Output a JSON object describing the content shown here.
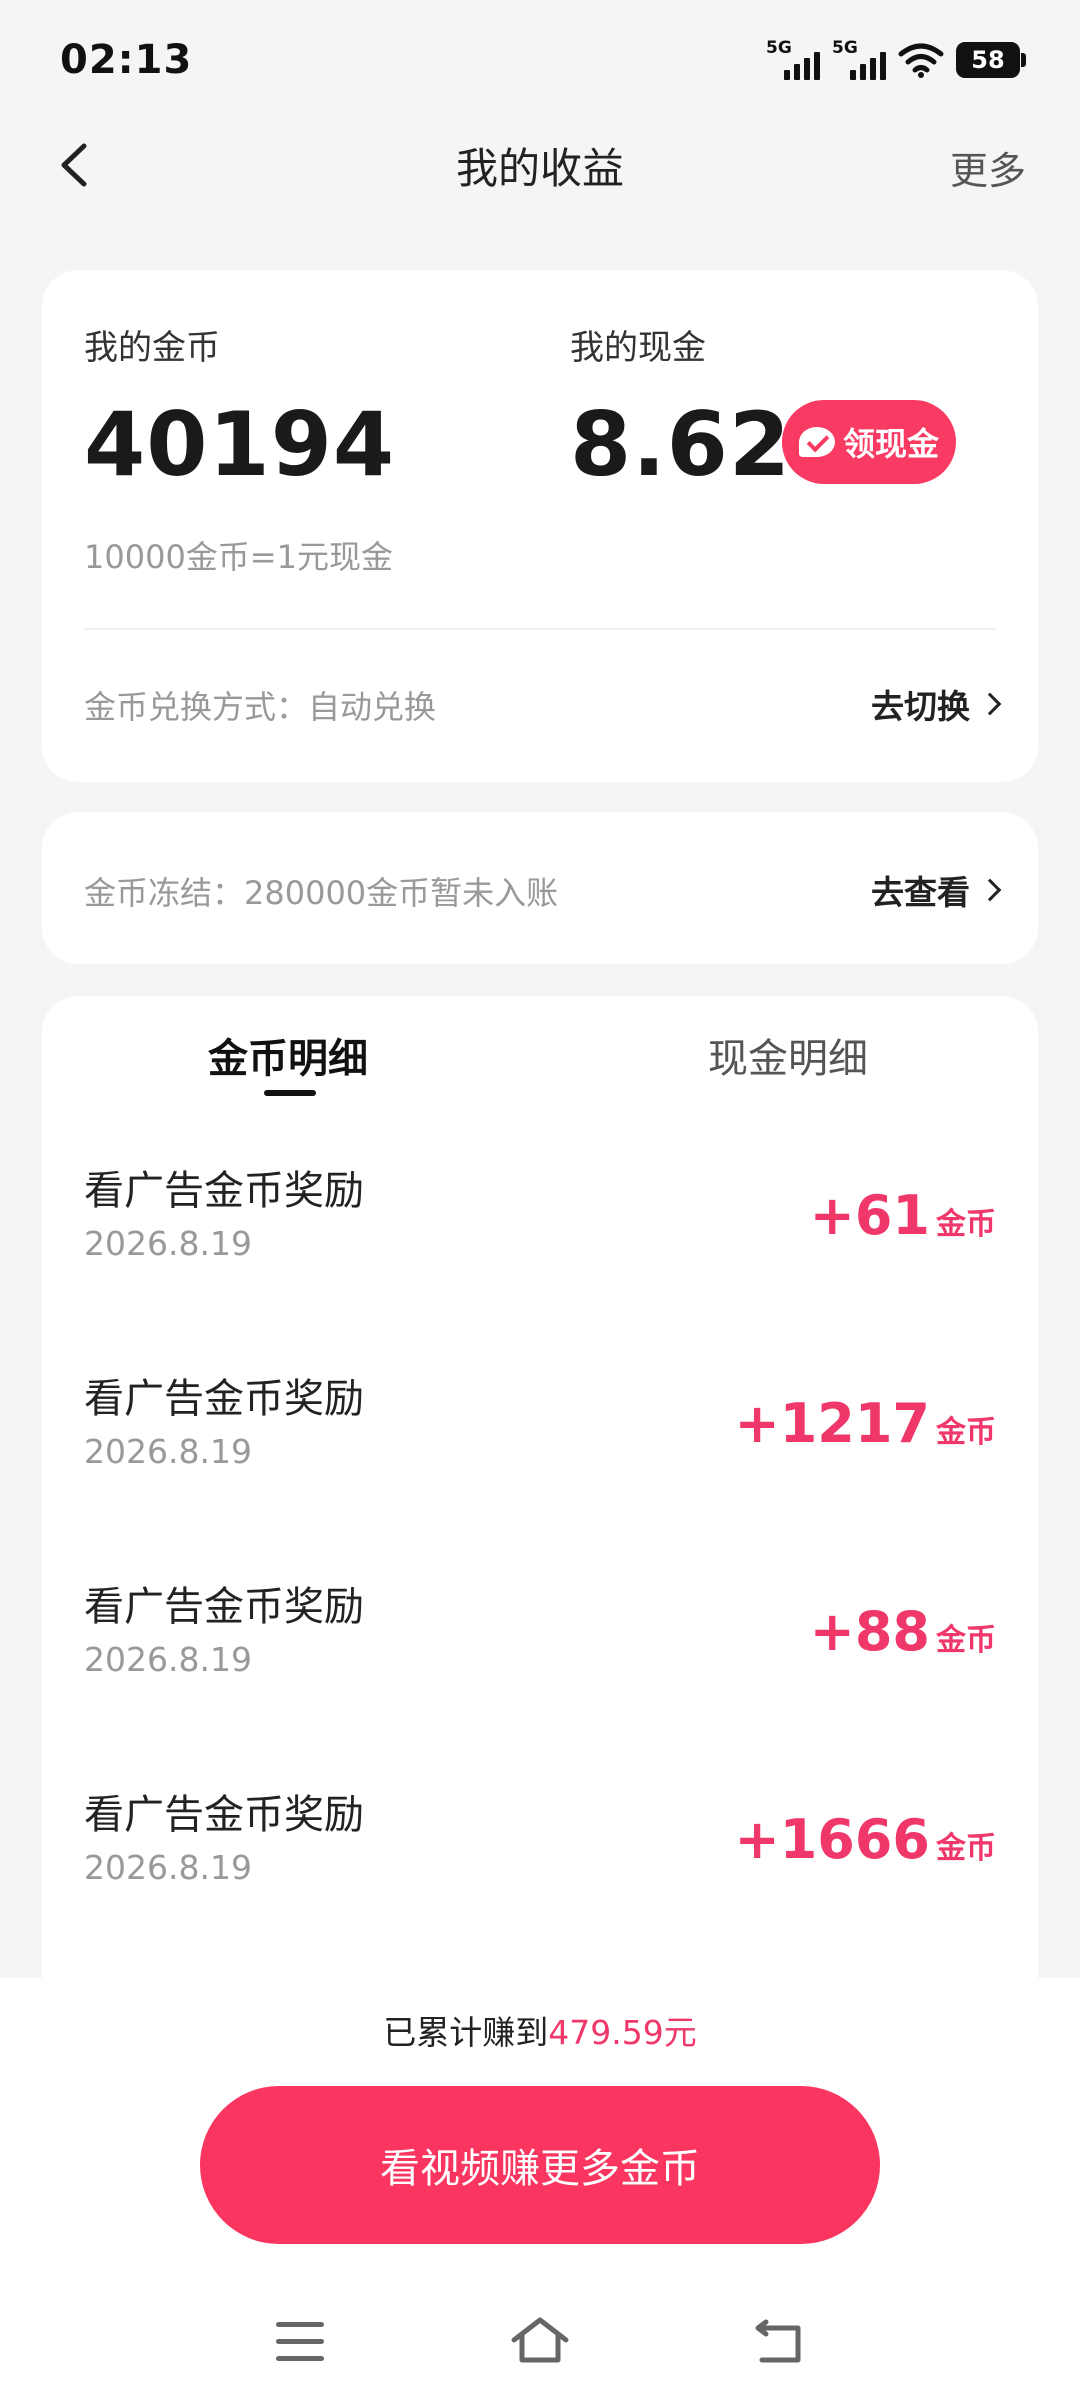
{
  "status_bar": {
    "time": "02:13",
    "signal1": "5G",
    "signal2": "5G",
    "battery": "58"
  },
  "nav": {
    "title": "我的收益",
    "more": "更多"
  },
  "balance": {
    "coins_label": "我的金币",
    "coins_value": "40194",
    "cash_label": "我的现金",
    "cash_value": "8.62",
    "claim_button": "领现金",
    "rate_text": "10000金币=1元现金",
    "exchange_text": "金币兑换方式：自动兑换",
    "exchange_link": "去切换"
  },
  "freeze": {
    "text": "金币冻结：280000金币暂未入账",
    "link": "去查看"
  },
  "tabs": [
    {
      "label": "金币明细",
      "active": true
    },
    {
      "label": "现金明细",
      "active": false
    }
  ],
  "records": [
    {
      "title": "看广告金币奖励",
      "date": "2026.8.19",
      "amount": "+61",
      "unit": "金币"
    },
    {
      "title": "看广告金币奖励",
      "date": "2026.8.19",
      "amount": "+1217",
      "unit": "金币"
    },
    {
      "title": "看广告金币奖励",
      "date": "2026.8.19",
      "amount": "+88",
      "unit": "金币"
    },
    {
      "title": "看广告金币奖励",
      "date": "2026.8.19",
      "amount": "+1666",
      "unit": "金币"
    }
  ],
  "footer": {
    "total_prefix": "已累计赚到",
    "total_amount": "479.59元",
    "main_button": "看视频赚更多金币"
  },
  "colors": {
    "accent": "#fa3560",
    "amount": "#f0376a"
  },
  "icons": {
    "back": "back-arrow-icon",
    "claim": "wallet-check-icon",
    "chevron": "chevron-right-icon",
    "menu": "menu-icon",
    "home": "home-icon",
    "sys_back": "back-icon"
  }
}
